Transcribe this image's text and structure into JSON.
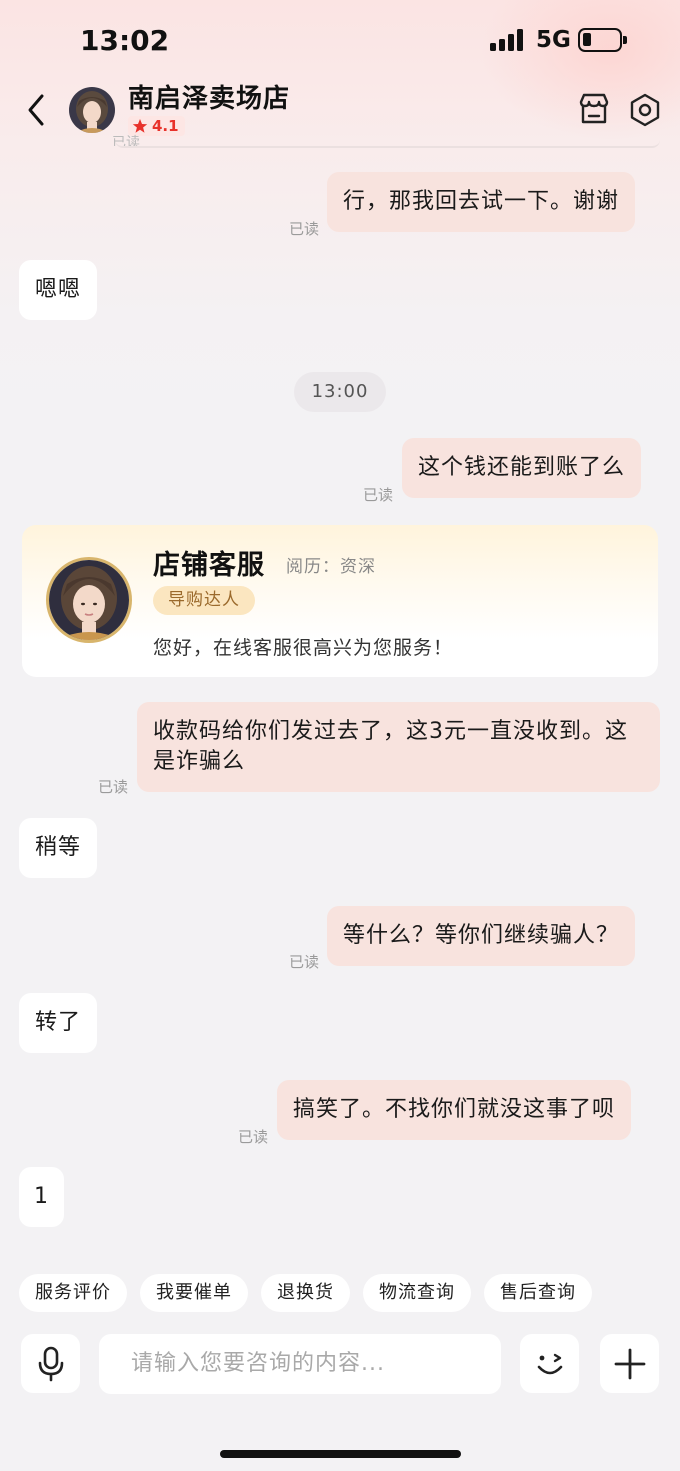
{
  "status_bar": {
    "time": "13:02",
    "network": "5G"
  },
  "header": {
    "shop_name": "南启泽卖场店",
    "rating": "4.1",
    "peek_read_label": "已读"
  },
  "messages": [
    {
      "side": "out",
      "text": "行，那我回去试一下。谢谢",
      "read": "已读"
    },
    {
      "side": "in",
      "text": "嗯嗯"
    },
    {
      "side": "out",
      "text": "这个钱还能到账了么",
      "read": "已读"
    },
    {
      "side": "out",
      "text": "收款码给你们发过去了，这3元一直没收到。这是诈骗么",
      "read": "已读"
    },
    {
      "side": "in",
      "text": "稍等"
    },
    {
      "side": "out",
      "text": "等什么？等你们继续骗人？",
      "read": "已读"
    },
    {
      "side": "in",
      "text": "转了"
    },
    {
      "side": "out",
      "text": "搞笑了。不找你们就没这事了呗",
      "read": "已读"
    },
    {
      "side": "in",
      "text": "1"
    }
  ],
  "time_divider": "13:00",
  "agent_card": {
    "name": "店铺客服",
    "experience": "阅历：资深",
    "badge": "导购达人",
    "greeting": "您好，在线客服很高兴为您服务！"
  },
  "quick_actions": [
    "服务评价",
    "我要催单",
    "退换货",
    "物流查询",
    "售后查询"
  ],
  "composer": {
    "placeholder": "请输入您要咨询的内容..."
  },
  "colors": {
    "outgoing_bubble": "#f8e3de",
    "incoming_bubble": "#ffffff",
    "rating_star": "#e8322b",
    "badge_text": "#9b6a2c"
  },
  "icons": {
    "back": "chevron-left-icon",
    "store": "store-icon",
    "settings": "hexagon-settings-icon",
    "voice": "microphone-icon",
    "emoji": "wink-face-icon",
    "more": "plus-icon"
  }
}
